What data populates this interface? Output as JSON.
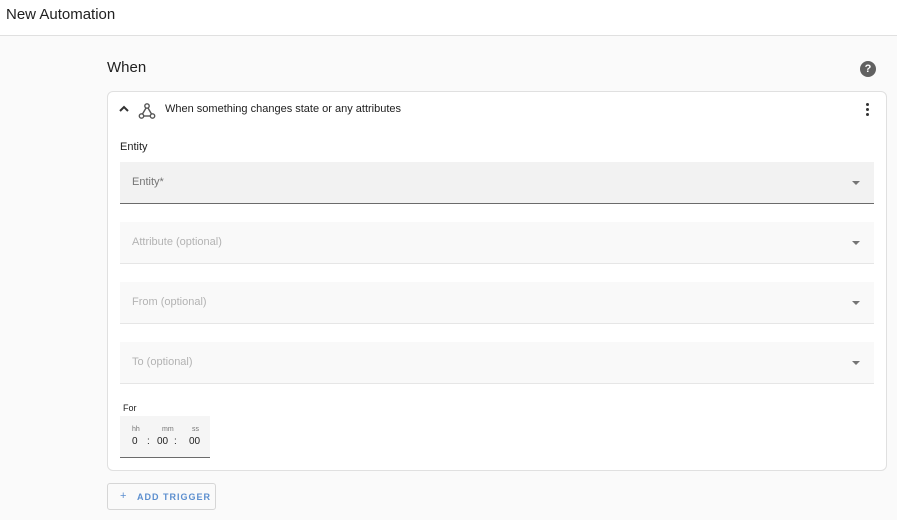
{
  "header": {
    "title": "New Automation"
  },
  "section": {
    "title": "When",
    "help_icon": "help-circle-icon",
    "help_glyph": "?"
  },
  "trigger_card": {
    "title": "When something changes state or any attributes",
    "icon": "state-change-icon",
    "entity_label": "Entity",
    "fields": {
      "entity": {
        "placeholder": "Entity*"
      },
      "attribute": {
        "placeholder": "Attribute (optional)"
      },
      "from": {
        "placeholder": "From (optional)"
      },
      "to": {
        "placeholder": "To (optional)"
      }
    },
    "for": {
      "label": "For",
      "units": {
        "hours": "hh",
        "minutes": "mm",
        "seconds": "ss"
      },
      "values": {
        "hours": "0",
        "minutes": "00",
        "seconds": "00"
      },
      "separator": ":"
    }
  },
  "add_trigger": {
    "label": "ADD TRIGGER",
    "icon_glyph": "+"
  },
  "colors": {
    "accent": "#5c8fcf",
    "background": "#fafafa"
  }
}
